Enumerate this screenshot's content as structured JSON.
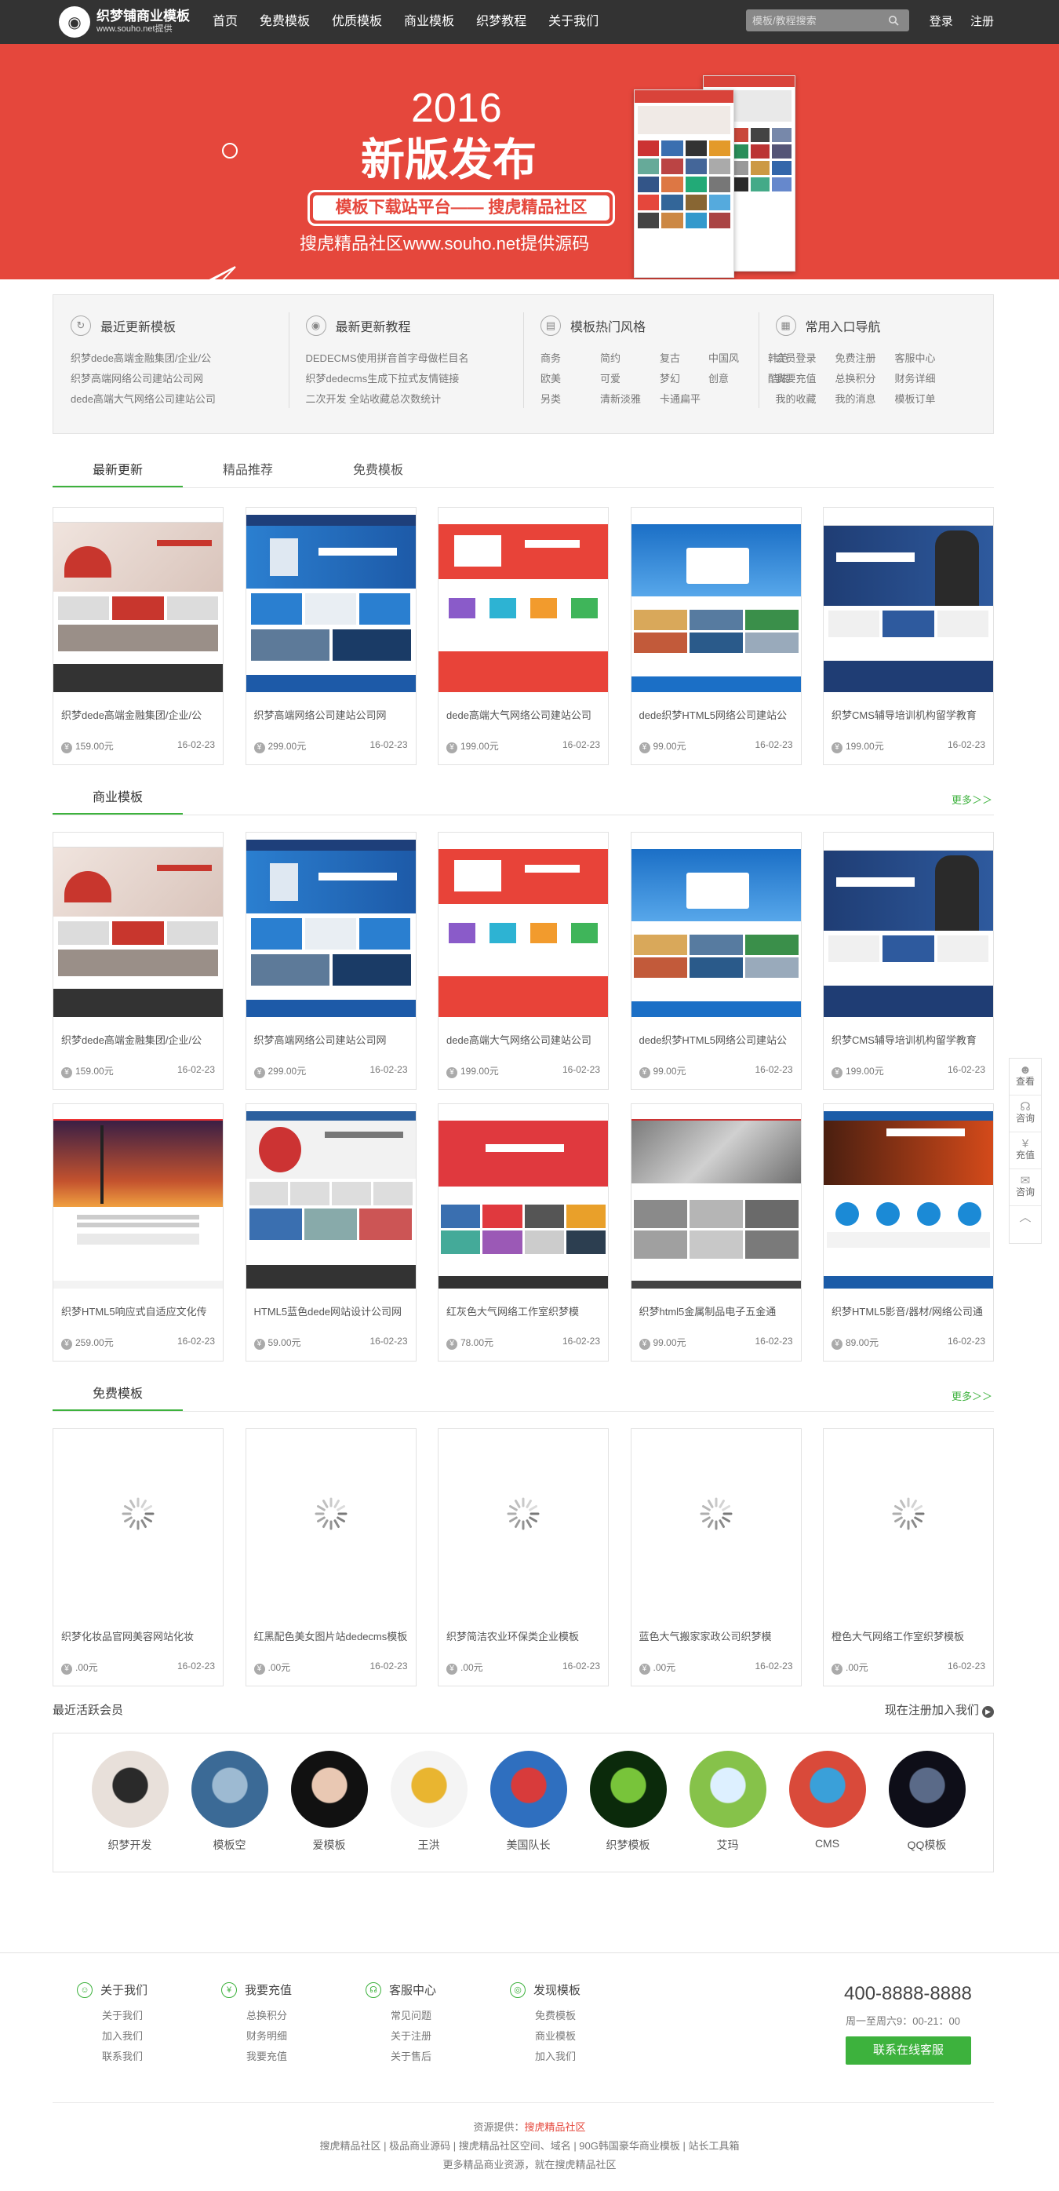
{
  "header": {
    "logo_title": "织梦铺商业模板",
    "logo_sub": "www.souho.net提供",
    "nav": [
      "首页",
      "免费模板",
      "优质模板",
      "商业模板",
      "织梦教程",
      "关于我们"
    ],
    "search_placeholder": "模板/教程搜索",
    "login": "登录",
    "register": "注册"
  },
  "banner": {
    "year": "2016",
    "headline": "新版发布",
    "box": "模板下载站平台—— 搜虎精品社区",
    "sub": "搜虎精品社区www.souho.net提供源码"
  },
  "quick": [
    {
      "title": "最近更新模板",
      "links": [
        "织梦dede高端金融集团/企业/公",
        "织梦高端网络公司建站公司网",
        "dede高端大气网络公司建站公司"
      ]
    },
    {
      "title": "最新更新教程",
      "links": [
        "DEDECMS使用拼音首字母做栏目名",
        "织梦dedecms生成下拉式友情链接",
        "二次开发 全站收藏总次数统计"
      ]
    },
    {
      "title": "模板热门风格",
      "grid": [
        "商务",
        "简约",
        "复古",
        "中国风",
        "韩范",
        "欧美",
        "可爱",
        "梦幻",
        "创意",
        "酷炫",
        "另类",
        "清新淡雅",
        "卡通扁平"
      ]
    },
    {
      "title": "常用入口导航",
      "grid": [
        "会员登录",
        "免费注册",
        "客服中心",
        "我要充值",
        "总换积分",
        "财务详细",
        "我的收藏",
        "我的消息",
        "模板订单"
      ]
    }
  ],
  "tabs1": [
    "最新更新",
    "精品推荐",
    "免费模板"
  ],
  "sec_business": "商业模板",
  "sec_free": "免费模板",
  "more": "更多＞＞",
  "row_latest": [
    {
      "title": "织梦dede高端金融集团/企业/公",
      "price": "159.00元",
      "date": "16-02-23",
      "theme": "fin"
    },
    {
      "title": "织梦高端网络公司建站公司网",
      "price": "299.00元",
      "date": "16-02-23",
      "theme": "blue"
    },
    {
      "title": "dede高端大气网络公司建站公司",
      "price": "199.00元",
      "date": "16-02-23",
      "theme": "red"
    },
    {
      "title": "dede织梦HTML5网络公司建站公",
      "price": "99.00元",
      "date": "16-02-23",
      "theme": "sky"
    },
    {
      "title": "织梦CMS辅导培训机构留学教育",
      "price": "199.00元",
      "date": "16-02-23",
      "theme": "edu"
    }
  ],
  "row_business1": [
    {
      "title": "织梦dede高端金融集团/企业/公",
      "price": "159.00元",
      "date": "16-02-23",
      "theme": "fin"
    },
    {
      "title": "织梦高端网络公司建站公司网",
      "price": "299.00元",
      "date": "16-02-23",
      "theme": "blue"
    },
    {
      "title": "dede高端大气网络公司建站公司",
      "price": "199.00元",
      "date": "16-02-23",
      "theme": "red"
    },
    {
      "title": "dede织梦HTML5网络公司建站公",
      "price": "99.00元",
      "date": "16-02-23",
      "theme": "sky"
    },
    {
      "title": "织梦CMS辅导培训机构留学教育",
      "price": "199.00元",
      "date": "16-02-23",
      "theme": "edu"
    }
  ],
  "row_business2": [
    {
      "title": "织梦HTML5响应式自适应文化传",
      "price": "259.00元",
      "date": "16-02-23",
      "theme": "sunset"
    },
    {
      "title": "HTML5蓝色dede网站设计公司网",
      "price": "59.00元",
      "date": "16-02-23",
      "theme": "white"
    },
    {
      "title": "红灰色大气网络工作室织梦模",
      "price": "78.00元",
      "date": "16-02-23",
      "theme": "ui"
    },
    {
      "title": "织梦html5金属制品电子五金通",
      "price": "99.00元",
      "date": "16-02-23",
      "theme": "metal"
    },
    {
      "title": "织梦HTML5影音/器材/网络公司通",
      "price": "89.00元",
      "date": "16-02-23",
      "theme": "media"
    }
  ],
  "row_free": [
    {
      "title": "织梦化妆品官网美容网站化妆",
      "price": ".00元",
      "date": "16-02-23"
    },
    {
      "title": "红黑配色美女图片站dedecms模板",
      "price": ".00元",
      "date": "16-02-23"
    },
    {
      "title": "织梦简洁农业环保类企业模板",
      "price": ".00元",
      "date": "16-02-23"
    },
    {
      "title": "蓝色大气搬家家政公司织梦模",
      "price": ".00元",
      "date": "16-02-23"
    },
    {
      "title": "橙色大气网络工作室织梦模板",
      "price": ".00元",
      "date": "16-02-23"
    }
  ],
  "members": {
    "title": "最近活跃会员",
    "join": "现在注册加入我们",
    "list": [
      {
        "name": "织梦开发",
        "colors": [
          "#e8e0da",
          "#2a2a2a"
        ]
      },
      {
        "name": "模板空",
        "colors": [
          "#3b6a96",
          "#9dbad2"
        ]
      },
      {
        "name": "爱模板",
        "colors": [
          "#111111",
          "#e9c8b3"
        ]
      },
      {
        "name": "王洪",
        "colors": [
          "#f4f4f4",
          "#e9b530"
        ]
      },
      {
        "name": "美国队长",
        "colors": [
          "#2f6fbf",
          "#d83b3b"
        ]
      },
      {
        "name": "织梦模板",
        "colors": [
          "#0b2a0b",
          "#78c43a"
        ]
      },
      {
        "name": "艾玛",
        "colors": [
          "#86c24a",
          "#ddf0ff"
        ]
      },
      {
        "name": "CMS",
        "colors": [
          "#d94a3a",
          "#3aa0d9"
        ]
      },
      {
        "name": "QQ模板",
        "colors": [
          "#0e0e18",
          "#5a6a88"
        ]
      }
    ]
  },
  "footer": {
    "cols": [
      {
        "title": "关于我们",
        "icon": "user-circle-icon",
        "glyph": "☺",
        "links": [
          "关于我们",
          "加入我们",
          "联系我们"
        ]
      },
      {
        "title": "我要充值",
        "icon": "yen-icon",
        "glyph": "¥",
        "links": [
          "总换积分",
          "财务明细",
          "我要充值"
        ]
      },
      {
        "title": "客服中心",
        "icon": "headset-icon",
        "glyph": "☊",
        "links": [
          "常见问题",
          "关于注册",
          "关于售后"
        ]
      },
      {
        "title": "发现模板",
        "icon": "compass-icon",
        "glyph": "◎",
        "links": [
          "免费模板",
          "商业模板",
          "加入我们"
        ]
      }
    ],
    "phone": "400-8888-8888",
    "hours": "周一至周六9：00-21：00",
    "cs_button": "联系在线客服",
    "source_label": "资源提供：",
    "source_name": "搜虎精品社区",
    "links_line": "搜虎精品社区 | 极品商业源码 | 搜虎精品社区空间、域名 | 90G韩国豪华商业模板 | 站长工具箱",
    "bottom_line": "更多精品商业资源，就在搜虎精品社区"
  },
  "side": [
    {
      "label": "查看",
      "icon": "user-icon",
      "glyph": "☻"
    },
    {
      "label": "咨询",
      "icon": "headset-icon",
      "glyph": "☊"
    },
    {
      "label": "充值",
      "icon": "yen-icon",
      "glyph": "¥"
    },
    {
      "label": "咨询",
      "icon": "chat-icon",
      "glyph": "✉"
    },
    {
      "label": "",
      "icon": "back-to-top-icon",
      "glyph": "︿"
    }
  ]
}
